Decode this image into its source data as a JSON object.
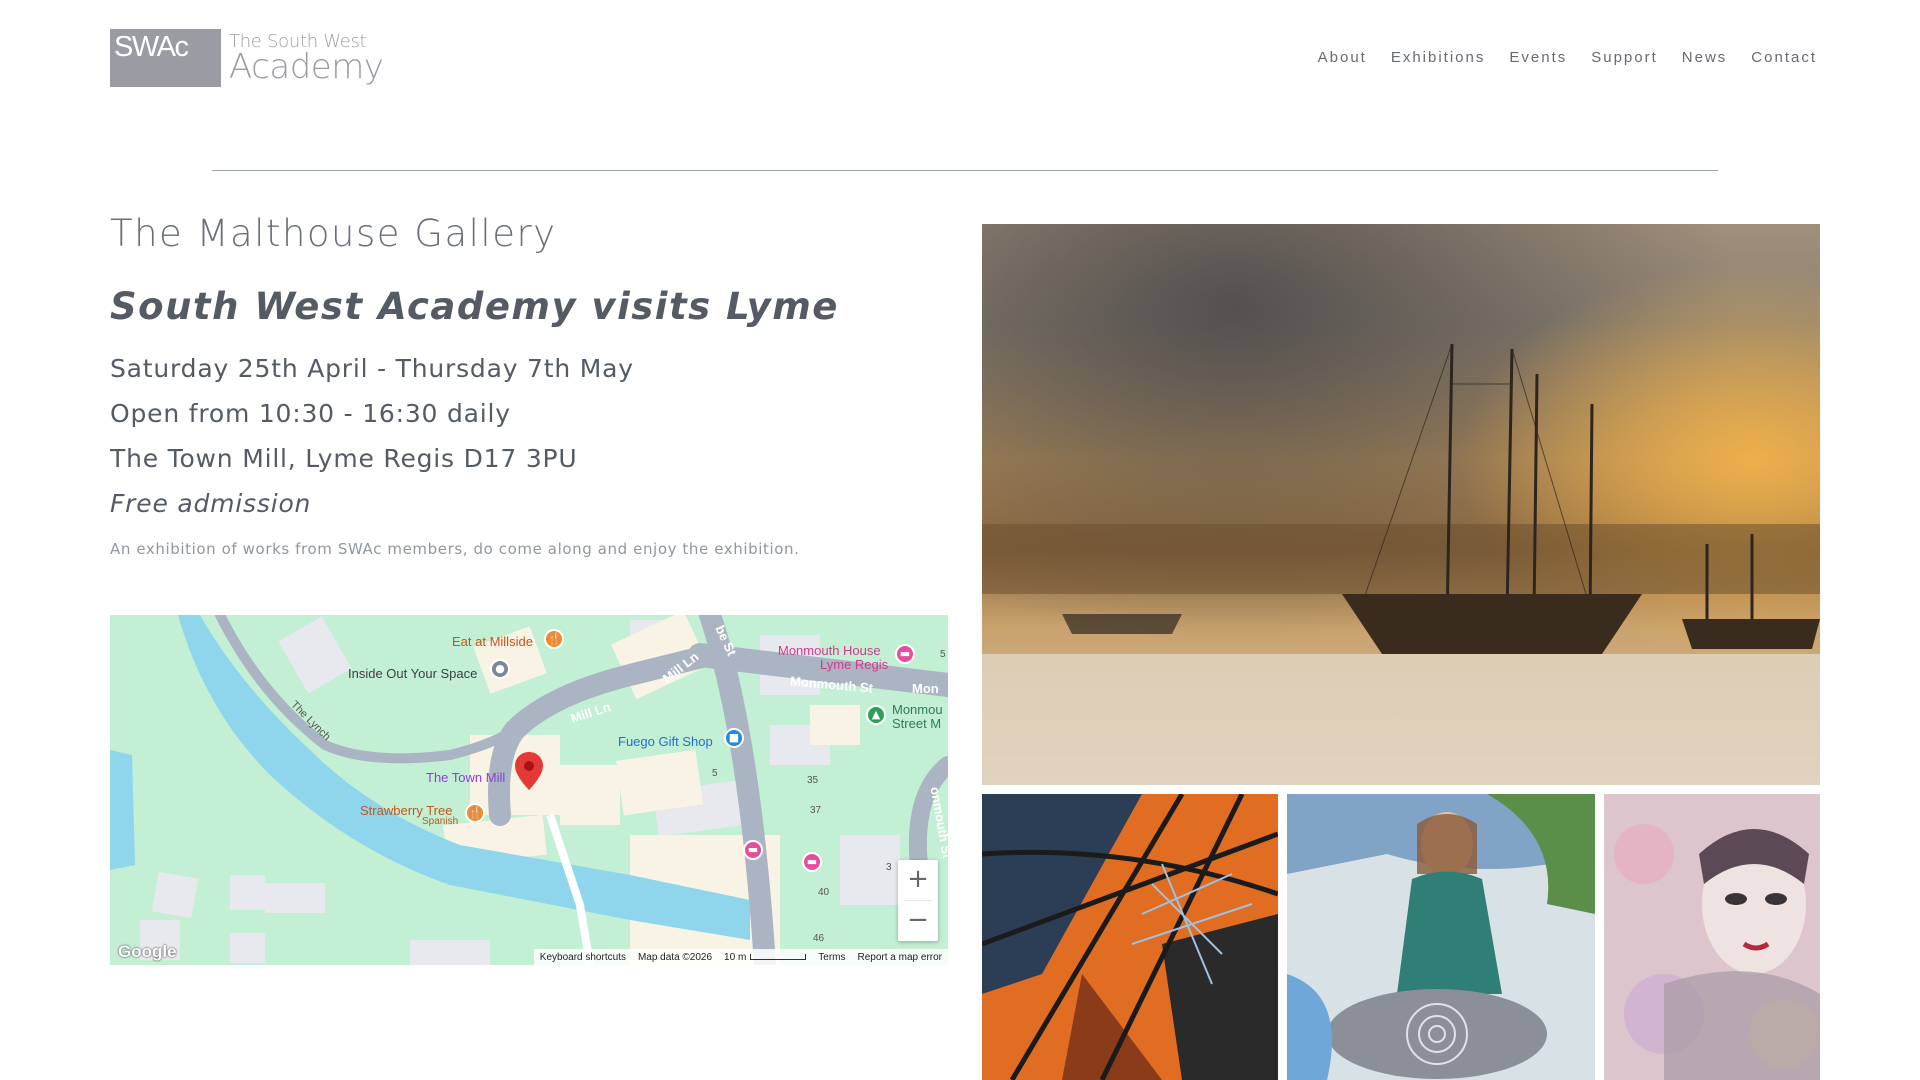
{
  "header": {
    "logo_abbr": "SWAc",
    "logo_line1": "The South West",
    "logo_line2": "Academy",
    "nav": [
      "About",
      "Exhibitions",
      "Events",
      "Support",
      "News",
      "Contact"
    ]
  },
  "main": {
    "title": "The Malthouse Gallery",
    "subtitle": "South West Academy visits Lyme",
    "dates": "Saturday 25th April - Thursday 7th May",
    "hours": "Open from 10:30 - 16:30 daily",
    "address": "The Town Mill, Lyme Regis D17 3PU",
    "admission": "Free admission",
    "description": "An exhibition of works from SWAc members, do come along and enjoy the exhibition."
  },
  "map": {
    "places": {
      "eat_at_millside": "Eat at Millside",
      "inside_out": "Inside Out Your Space",
      "monmouth_house": "Monmouth House",
      "monmouth_house_2": "Lyme Regis",
      "monmouth_st": "Monmouth St",
      "monmouth_st_cut": "Mon",
      "monmouth_st_2": "Monmou",
      "monmouth_st_3": "Street M",
      "mill_ln": "Mill Ln",
      "mill_ln_2": "Mill Ln",
      "combe_st": "be St",
      "the_lynch": "The Lynch",
      "fuego": "Fuego Gift Shop",
      "town_mill": "The Town Mill",
      "strawberry": "Strawberry Tree",
      "strawberry_sub": "Spanish",
      "monmouth_vert": "onmouth St",
      "n5": "5",
      "n5b": "5",
      "n35": "35",
      "n37": "37",
      "n3": "3",
      "n40": "40",
      "n46": "46"
    },
    "zoom_in": "+",
    "zoom_out": "−",
    "google": "Google",
    "keyboard": "Keyboard shortcuts",
    "map_data": "Map data ©2026",
    "scale": "10 m",
    "terms": "Terms",
    "report": "Report a map error"
  },
  "colors": {
    "map_land": "#c3efd4",
    "water": "#8fd6ec",
    "road": "#aab4c2",
    "building": "#f9f3e5",
    "pin_red": "#e53935"
  }
}
